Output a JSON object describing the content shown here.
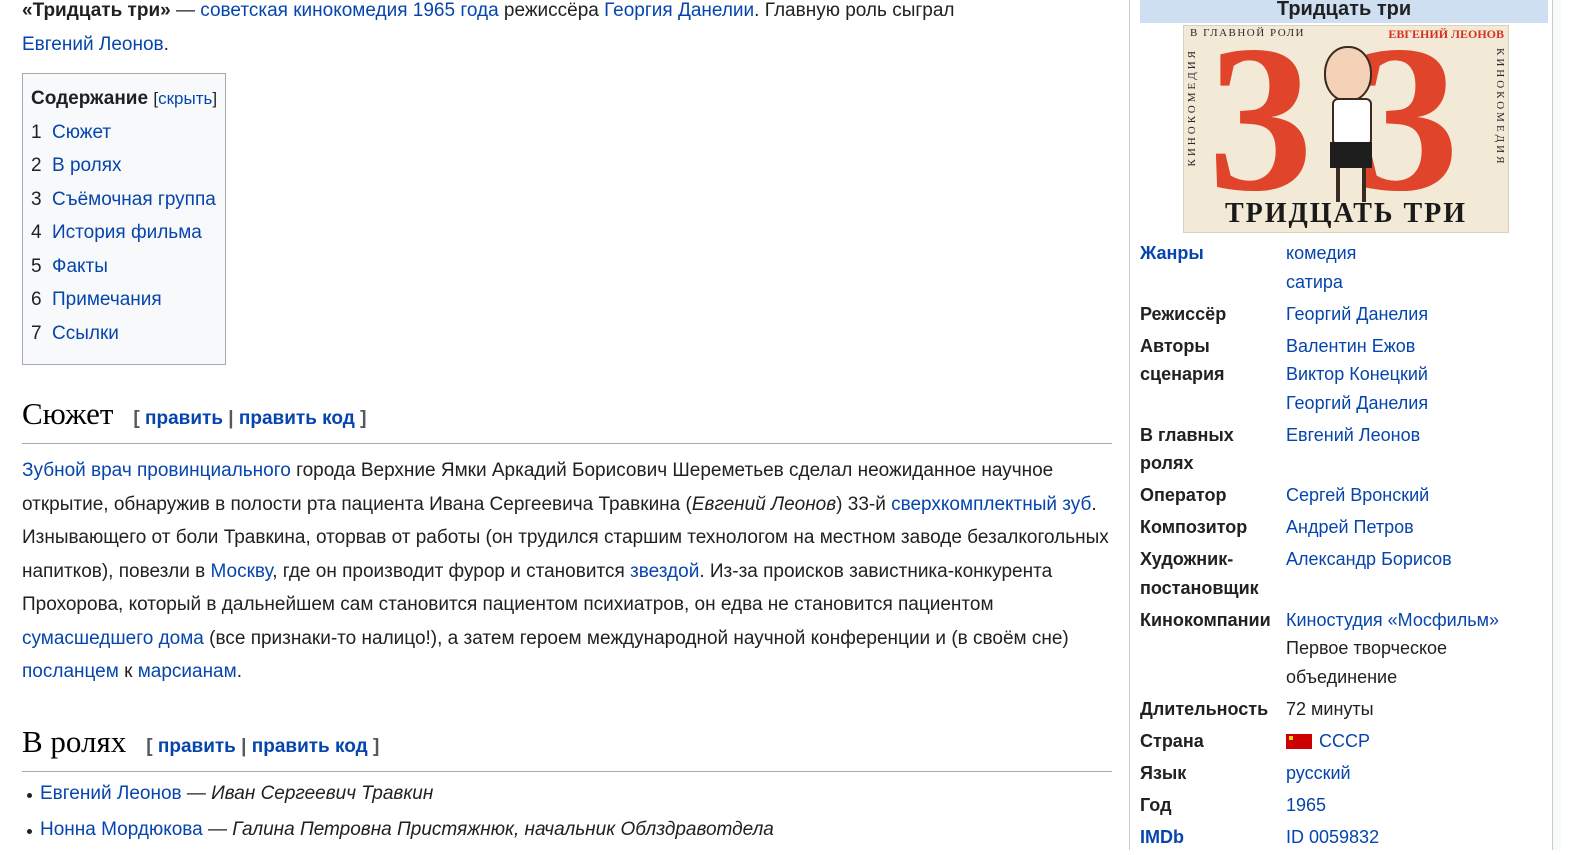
{
  "lead": {
    "title_bold": "«Тридцать три»",
    "dash": " — ",
    "link_genre": "советская кинокомедия 1965 года",
    "text_director_pre": " режиссёра ",
    "link_director": "Георгия Данелии",
    "text_lead_role": ". Главную роль сыграл ",
    "link_lead_actor": "Евгений Леонов",
    "text_end": "."
  },
  "toc": {
    "title": "Содержание",
    "toggle_open": "[",
    "toggle_label": "скрыть",
    "toggle_close": "]",
    "items": [
      {
        "num": "1",
        "label": "Сюжет"
      },
      {
        "num": "2",
        "label": "В ролях"
      },
      {
        "num": "3",
        "label": "Съёмочная группа"
      },
      {
        "num": "4",
        "label": "История фильма"
      },
      {
        "num": "5",
        "label": "Факты"
      },
      {
        "num": "6",
        "label": "Примечания"
      },
      {
        "num": "7",
        "label": "Ссылки"
      }
    ]
  },
  "edit": {
    "open": "[ ",
    "edit": "править",
    "sep": " | ",
    "edit_code": "править код",
    "close": " ]"
  },
  "plot": {
    "heading": "Сюжет",
    "l1": "Зубной врач провинциального",
    "t1": " города Верхние Ямки Аркадий Борисович Шереметьев сделал неожиданное научное открытие, обнаружив в полости рта пациента Ивана Сергеевича Травкина (",
    "i1": "Евгений Леонов",
    "t2": ") 33-й ",
    "l2": "сверхкомплектный зуб",
    "t3": ". Изнывающего от боли Травкина, оторвав от работы (он трудился старшим технологом на местном заводе безалкогольных напитков), повезли в ",
    "l3": "Москву",
    "t4": ", где он производит фурор и становится ",
    "l4": "звездой",
    "t5": ". Из-за происков завистника-конкурента Прохорова, который в дальнейшем сам становится пациентом психиатров, он едва не становится пациентом ",
    "l5": "сумасшедшего дома",
    "t6": " (все признаки-то налицо!), а затем героем международной научной конференции и (в своём сне) ",
    "l6": "посланцем",
    "t7": " к ",
    "l7": "марсианам",
    "t8": "."
  },
  "cast": {
    "heading": "В ролях",
    "items": [
      {
        "actor": "Евгений Леонов",
        "dash": " — ",
        "role": "Иван Сергеевич Травкин"
      },
      {
        "actor": "Нонна Мордюкова",
        "dash": " — ",
        "role": "Галина Петровна Пристяжнюк, начальник Облздравотдела"
      }
    ]
  },
  "infobox": {
    "title": "Тридцать три",
    "poster": {
      "top_left": "В ГЛАВНОЙ РОЛИ",
      "top_right": "ЕВГЕНИЙ ЛЕОНОВ",
      "side": "КИНОКОМЕДИЯ",
      "big_number_1": "3",
      "big_number_2": "3",
      "bottom": "ТРИДЦАТЬ ТРИ"
    },
    "rows": {
      "genres": {
        "label": "Жанры",
        "values": [
          "комедия",
          "сатира"
        ]
      },
      "director": {
        "label": "Режиссёр",
        "values": [
          "Георгий Данелия"
        ]
      },
      "writers": {
        "label_1": "Авторы",
        "label_2": "сценария",
        "values": [
          "Валентин Ежов",
          "Виктор Конецкий",
          "Георгий Данелия"
        ]
      },
      "starring": {
        "label_1": "В главных",
        "label_2": "ролях",
        "values": [
          "Евгений Леонов"
        ]
      },
      "operator": {
        "label": "Оператор",
        "values": [
          "Сергей Вронский"
        ]
      },
      "composer": {
        "label": "Композитор",
        "values": [
          "Андрей Петров"
        ]
      },
      "designer": {
        "label_1": "Художник-",
        "label_2": "постановщик",
        "values": [
          "Александр Борисов"
        ]
      },
      "studio": {
        "label": "Кинокомпании",
        "link": "Киностудия «Мосфильм»",
        "plain_1": "Первое творческое",
        "plain_2": "объединение"
      },
      "duration": {
        "label": "Длительность",
        "value": "72 минуты"
      },
      "country": {
        "label": "Страна",
        "value": "СССР"
      },
      "language": {
        "label": "Язык",
        "value": "русский"
      },
      "year": {
        "label": "Год",
        "value": "1965"
      },
      "imdb": {
        "label": "IMDb",
        "value": "ID 0059832"
      }
    }
  },
  "colors": {
    "link": "#0645ad",
    "infobox_title_bg": "#cedff2",
    "toc_bg": "#f8f9fa",
    "poster_red": "#e0452b",
    "flag_red": "#cc0000"
  }
}
